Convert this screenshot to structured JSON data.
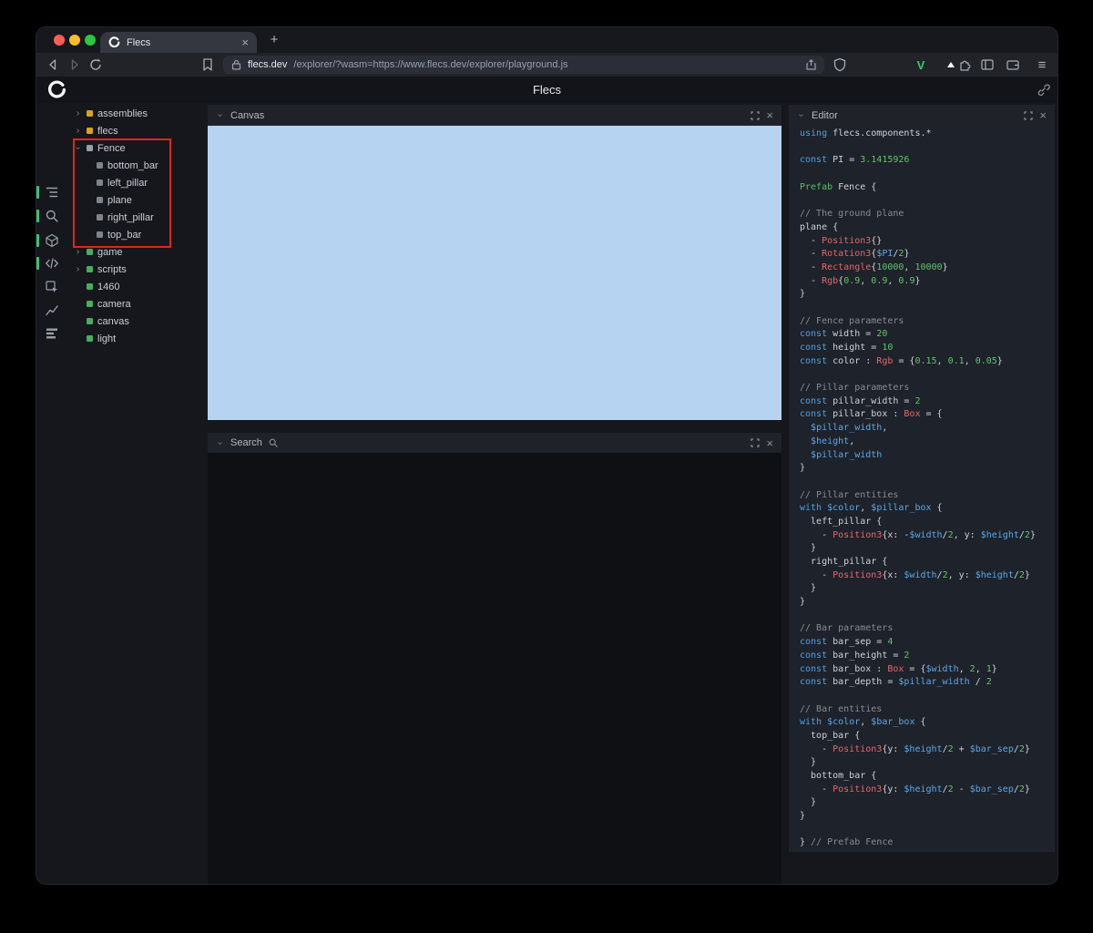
{
  "icons": {
    "chevron": "›",
    "close": "×",
    "menu": "≡"
  },
  "browser": {
    "tab": {
      "title": "Flecs"
    },
    "new_tab_button": "+",
    "address": {
      "host": "flecs.dev",
      "path": "/explorer/?wasm=https://www.flecs.dev/explorer/playground.js"
    }
  },
  "app": {
    "title": "Flecs"
  },
  "sidebar": {
    "icons": [
      {
        "name": "entity-tree",
        "active": true
      },
      {
        "name": "search",
        "active": true
      },
      {
        "name": "cube",
        "active": true
      },
      {
        "name": "code",
        "active": true
      },
      {
        "name": "inspect",
        "active": false
      },
      {
        "name": "chart",
        "active": false
      },
      {
        "name": "stats",
        "active": false
      }
    ]
  },
  "tree": {
    "items": [
      {
        "label": "assemblies",
        "chevron": ">",
        "dot": "yellow",
        "indent": 0
      },
      {
        "label": "flecs",
        "chevron": ">",
        "dot": "yellow",
        "indent": 0
      },
      {
        "label": "Fence",
        "chevron": "v",
        "dot": "gray",
        "indent": 0
      },
      {
        "label": "bottom_bar",
        "chevron": "",
        "dot": "graydim",
        "indent": 1
      },
      {
        "label": "left_pillar",
        "chevron": "",
        "dot": "graydim",
        "indent": 1
      },
      {
        "label": "plane",
        "chevron": "",
        "dot": "graydim",
        "indent": 1
      },
      {
        "label": "right_pillar",
        "chevron": "",
        "dot": "graydim",
        "indent": 1
      },
      {
        "label": "top_bar",
        "chevron": "",
        "dot": "graydim",
        "indent": 1
      },
      {
        "label": "game",
        "chevron": ">",
        "dot": "green",
        "indent": 0
      },
      {
        "label": "scripts",
        "chevron": ">",
        "dot": "green",
        "indent": 0
      },
      {
        "label": "1460",
        "chevron": "",
        "dot": "green",
        "indent": 0
      },
      {
        "label": "camera",
        "chevron": "",
        "dot": "green",
        "indent": 0
      },
      {
        "label": "canvas",
        "chevron": "",
        "dot": "green",
        "indent": 0
      },
      {
        "label": "light",
        "chevron": "",
        "dot": "green",
        "indent": 0
      }
    ]
  },
  "panels": {
    "canvas": {
      "title": "Canvas"
    },
    "search": {
      "title": "Search"
    },
    "editor": {
      "title": "Editor"
    }
  },
  "editor": {
    "code": [
      [
        [
          "kw",
          "using"
        ],
        [
          "pl",
          " flecs.components.*"
        ]
      ],
      [],
      [
        [
          "kw",
          "const"
        ],
        [
          "pl",
          " PI = "
        ],
        [
          "num",
          "3.1415926"
        ]
      ],
      [],
      [
        [
          "pf",
          "Prefab"
        ],
        [
          "pl",
          " Fence {"
        ]
      ],
      [],
      [
        [
          "cm",
          "// The ground plane"
        ]
      ],
      [
        [
          "pl",
          "plane {"
        ]
      ],
      [
        [
          "pl",
          "  - "
        ],
        [
          "ty",
          "Position3"
        ],
        [
          "pl",
          "{}"
        ]
      ],
      [
        [
          "pl",
          "  - "
        ],
        [
          "ty",
          "Rotation3"
        ],
        [
          "pl",
          "{"
        ],
        [
          "vr",
          "$PI"
        ],
        [
          "pl",
          "/"
        ],
        [
          "num",
          "2"
        ],
        [
          "pl",
          "}"
        ]
      ],
      [
        [
          "pl",
          "  - "
        ],
        [
          "ty",
          "Rectangle"
        ],
        [
          "pl",
          "{"
        ],
        [
          "num",
          "10000"
        ],
        [
          "pl",
          ", "
        ],
        [
          "num",
          "10000"
        ],
        [
          "pl",
          "}"
        ]
      ],
      [
        [
          "pl",
          "  - "
        ],
        [
          "ty",
          "Rgb"
        ],
        [
          "pl",
          "{"
        ],
        [
          "num",
          "0.9"
        ],
        [
          "pl",
          ", "
        ],
        [
          "num",
          "0.9"
        ],
        [
          "pl",
          ", "
        ],
        [
          "num",
          "0.9"
        ],
        [
          "pl",
          "}"
        ]
      ],
      [
        [
          "pl",
          "}"
        ]
      ],
      [],
      [
        [
          "cm",
          "// Fence parameters"
        ]
      ],
      [
        [
          "kw",
          "const"
        ],
        [
          "pl",
          " width = "
        ],
        [
          "num",
          "20"
        ]
      ],
      [
        [
          "kw",
          "const"
        ],
        [
          "pl",
          " height = "
        ],
        [
          "num",
          "10"
        ]
      ],
      [
        [
          "kw",
          "const"
        ],
        [
          "pl",
          " color : "
        ],
        [
          "ty",
          "Rgb"
        ],
        [
          "pl",
          " = {"
        ],
        [
          "num",
          "0.15"
        ],
        [
          "pl",
          ", "
        ],
        [
          "num",
          "0.1"
        ],
        [
          "pl",
          ", "
        ],
        [
          "num",
          "0.05"
        ],
        [
          "pl",
          "}"
        ]
      ],
      [],
      [
        [
          "cm",
          "// Pillar parameters"
        ]
      ],
      [
        [
          "kw",
          "const"
        ],
        [
          "pl",
          " pillar_width = "
        ],
        [
          "num",
          "2"
        ]
      ],
      [
        [
          "kw",
          "const"
        ],
        [
          "pl",
          " pillar_box : "
        ],
        [
          "ty",
          "Box"
        ],
        [
          "pl",
          " = {"
        ]
      ],
      [
        [
          "pl",
          "  "
        ],
        [
          "vr",
          "$pillar_width"
        ],
        [
          "pl",
          ","
        ]
      ],
      [
        [
          "pl",
          "  "
        ],
        [
          "vr",
          "$height"
        ],
        [
          "pl",
          ","
        ]
      ],
      [
        [
          "pl",
          "  "
        ],
        [
          "vr",
          "$pillar_width"
        ]
      ],
      [
        [
          "pl",
          "}"
        ]
      ],
      [],
      [
        [
          "cm",
          "// Pillar entities"
        ]
      ],
      [
        [
          "kw",
          "with"
        ],
        [
          "pl",
          " "
        ],
        [
          "vr",
          "$color"
        ],
        [
          "pl",
          ", "
        ],
        [
          "vr",
          "$pillar_box"
        ],
        [
          "pl",
          " {"
        ]
      ],
      [
        [
          "pl",
          "  left_pillar {"
        ]
      ],
      [
        [
          "pl",
          "    - "
        ],
        [
          "ty",
          "Position3"
        ],
        [
          "pl",
          "{x: -"
        ],
        [
          "vr",
          "$width"
        ],
        [
          "pl",
          "/"
        ],
        [
          "num",
          "2"
        ],
        [
          "pl",
          ", y: "
        ],
        [
          "vr",
          "$height"
        ],
        [
          "pl",
          "/"
        ],
        [
          "num",
          "2"
        ],
        [
          "pl",
          "}"
        ]
      ],
      [
        [
          "pl",
          "  }"
        ]
      ],
      [
        [
          "pl",
          "  right_pillar {"
        ]
      ],
      [
        [
          "pl",
          "    - "
        ],
        [
          "ty",
          "Position3"
        ],
        [
          "pl",
          "{x: "
        ],
        [
          "vr",
          "$width"
        ],
        [
          "pl",
          "/"
        ],
        [
          "num",
          "2"
        ],
        [
          "pl",
          ", y: "
        ],
        [
          "vr",
          "$height"
        ],
        [
          "pl",
          "/"
        ],
        [
          "num",
          "2"
        ],
        [
          "pl",
          "}"
        ]
      ],
      [
        [
          "pl",
          "  }"
        ]
      ],
      [
        [
          "pl",
          "}"
        ]
      ],
      [],
      [
        [
          "cm",
          "// Bar parameters"
        ]
      ],
      [
        [
          "kw",
          "const"
        ],
        [
          "pl",
          " bar_sep = "
        ],
        [
          "num",
          "4"
        ]
      ],
      [
        [
          "kw",
          "const"
        ],
        [
          "pl",
          " bar_height = "
        ],
        [
          "num",
          "2"
        ]
      ],
      [
        [
          "kw",
          "const"
        ],
        [
          "pl",
          " bar_box : "
        ],
        [
          "ty",
          "Box"
        ],
        [
          "pl",
          " = {"
        ],
        [
          "vr",
          "$width"
        ],
        [
          "pl",
          ", "
        ],
        [
          "num",
          "2"
        ],
        [
          "pl",
          ", "
        ],
        [
          "num",
          "1"
        ],
        [
          "pl",
          "}"
        ]
      ],
      [
        [
          "kw",
          "const"
        ],
        [
          "pl",
          " bar_depth = "
        ],
        [
          "vr",
          "$pillar_width"
        ],
        [
          "pl",
          " / "
        ],
        [
          "num",
          "2"
        ]
      ],
      [],
      [
        [
          "cm",
          "// Bar entities"
        ]
      ],
      [
        [
          "kw",
          "with"
        ],
        [
          "pl",
          " "
        ],
        [
          "vr",
          "$color"
        ],
        [
          "pl",
          ", "
        ],
        [
          "vr",
          "$bar_box"
        ],
        [
          "pl",
          " {"
        ]
      ],
      [
        [
          "pl",
          "  top_bar {"
        ]
      ],
      [
        [
          "pl",
          "    - "
        ],
        [
          "ty",
          "Position3"
        ],
        [
          "pl",
          "{y: "
        ],
        [
          "vr",
          "$height"
        ],
        [
          "pl",
          "/"
        ],
        [
          "num",
          "2"
        ],
        [
          "pl",
          " + "
        ],
        [
          "vr",
          "$bar_sep"
        ],
        [
          "pl",
          "/"
        ],
        [
          "num",
          "2"
        ],
        [
          "pl",
          "}"
        ]
      ],
      [
        [
          "pl",
          "  }"
        ]
      ],
      [
        [
          "pl",
          "  bottom_bar {"
        ]
      ],
      [
        [
          "pl",
          "    - "
        ],
        [
          "ty",
          "Position3"
        ],
        [
          "pl",
          "{y: "
        ],
        [
          "vr",
          "$height"
        ],
        [
          "pl",
          "/"
        ],
        [
          "num",
          "2"
        ],
        [
          "pl",
          " - "
        ],
        [
          "vr",
          "$bar_sep"
        ],
        [
          "pl",
          "/"
        ],
        [
          "num",
          "2"
        ],
        [
          "pl",
          "}"
        ]
      ],
      [
        [
          "pl",
          "  }"
        ]
      ],
      [
        [
          "pl",
          "}"
        ]
      ],
      [],
      [
        [
          "pl",
          "} "
        ],
        [
          "cm",
          "// Prefab Fence"
        ]
      ]
    ]
  },
  "colors": {
    "canvas_blue": "#b6d4f1",
    "accent_green": "#3fbf78",
    "module_yellow": "#d7a41c",
    "entity_green": "#48ad60",
    "keyword_blue": "#51a0e0",
    "type_red": "#e2686d",
    "number_green": "#63c46a",
    "comment_gray": "#878d95",
    "annotation_red": "#e0251b"
  }
}
